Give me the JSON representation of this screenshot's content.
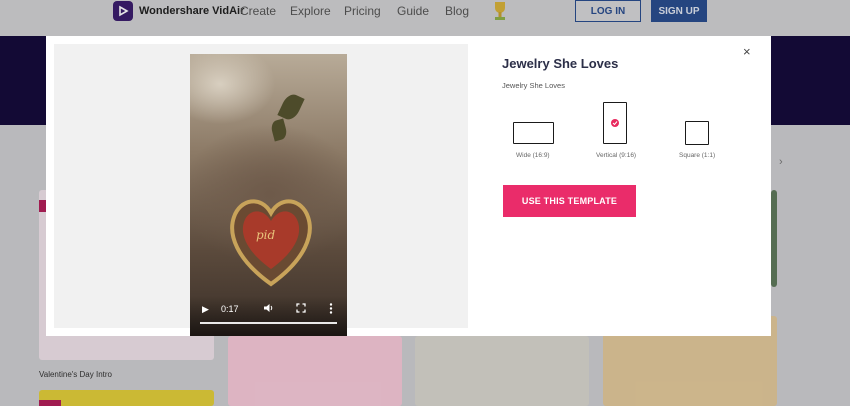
{
  "nav": {
    "brand": "Wondershare VidAir",
    "links": [
      "Create",
      "Explore",
      "Pricing",
      "Guide",
      "Blog"
    ],
    "login_label": "LOG IN",
    "signup_label": "SIGN UP"
  },
  "background": {
    "card_label": "Valentine's Day Intro"
  },
  "modal": {
    "title": "Jewelry She Loves",
    "subtitle": "Jewelry She Loves",
    "close_glyph": "×",
    "video": {
      "time": "0:17",
      "play_glyph": "▶",
      "progress": 1.0
    },
    "ratios": [
      {
        "label": "Wide (16:9)",
        "selected": false
      },
      {
        "label": "Vertical (9:16)",
        "selected": true
      },
      {
        "label": "Square (1:1)",
        "selected": false
      }
    ],
    "cta_label": "USE THIS TEMPLATE"
  },
  "colors": {
    "accent": "#ea2c6a",
    "nav_blue": "#2a4d8f",
    "hero_bg": "#160c3c"
  }
}
